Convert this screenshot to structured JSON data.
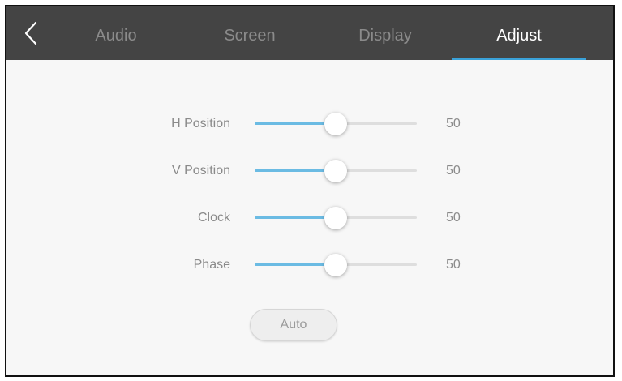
{
  "tabs": [
    {
      "label": "Audio",
      "active": false
    },
    {
      "label": "Screen",
      "active": false
    },
    {
      "label": "Display",
      "active": false
    },
    {
      "label": "Adjust",
      "active": true
    }
  ],
  "back_icon": "chevron-left-icon",
  "settings": [
    {
      "label": "H Position",
      "value": "50",
      "level": 0.5
    },
    {
      "label": "V Position",
      "value": "50",
      "level": 0.5
    },
    {
      "label": "Clock",
      "value": "50",
      "level": 0.5
    },
    {
      "label": "Phase",
      "value": "50",
      "level": 0.5
    }
  ],
  "auto_button_label": "Auto",
  "colors": {
    "tabbar_bg": "#444444",
    "active_tab_text": "#ffffff",
    "inactive_tab_text": "#8b8b8b",
    "accent": "#3aa2d9",
    "slider_fill": "#6bbbe3",
    "content_bg": "#f7f7f7"
  }
}
